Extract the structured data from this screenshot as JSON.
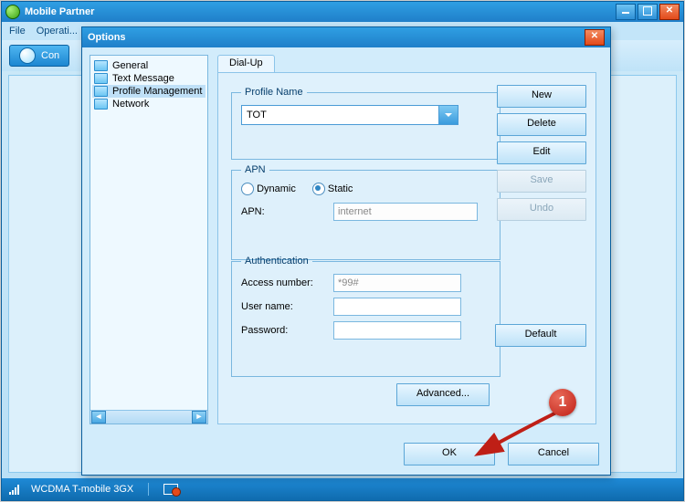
{
  "app": {
    "title": "Mobile Partner"
  },
  "menu": {
    "file": "File",
    "operation": "Operati..."
  },
  "toolbar": {
    "connect": "Con"
  },
  "status": {
    "network": "WCDMA  T-mobile 3GX"
  },
  "options": {
    "title": "Options",
    "tree": {
      "items": [
        {
          "label": "General"
        },
        {
          "label": "Text Message"
        },
        {
          "label": "Profile Management"
        },
        {
          "label": "Network"
        }
      ]
    },
    "tab": {
      "dialup": "Dial-Up"
    },
    "profile": {
      "legend": "Profile Name",
      "value": "TOT"
    },
    "apn": {
      "legend": "APN",
      "dynamic_label": "Dynamic",
      "static_label": "Static",
      "apn_label": "APN:",
      "apn_value": "internet"
    },
    "auth": {
      "legend": "Authentication",
      "access_label": "Access number:",
      "access_value": "*99#",
      "user_label": "User name:",
      "user_value": "",
      "pass_label": "Password:",
      "pass_value": ""
    },
    "buttons": {
      "new": "New",
      "delete": "Delete",
      "edit": "Edit",
      "save": "Save",
      "undo": "Undo",
      "default": "Default",
      "advanced": "Advanced...",
      "ok": "OK",
      "cancel": "Cancel"
    }
  },
  "annotation": {
    "step1": "1"
  }
}
